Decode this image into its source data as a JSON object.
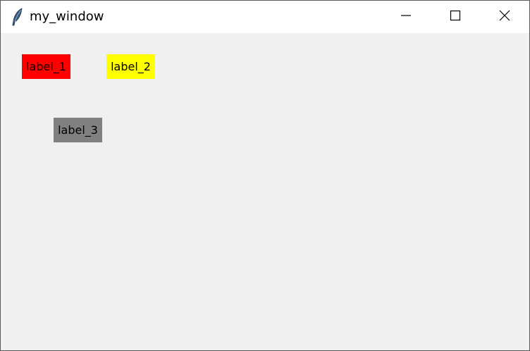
{
  "window": {
    "title": "my_window",
    "icon": "feather-icon",
    "controls": {
      "minimize_icon": "minimize-icon",
      "maximize_icon": "maximize-icon",
      "close_icon": "close-icon"
    }
  },
  "labels": [
    {
      "text": "label_1",
      "bg": "#ff0000"
    },
    {
      "text": "label_2",
      "bg": "#ffff00"
    },
    {
      "text": "label_3",
      "bg": "#808080"
    }
  ]
}
